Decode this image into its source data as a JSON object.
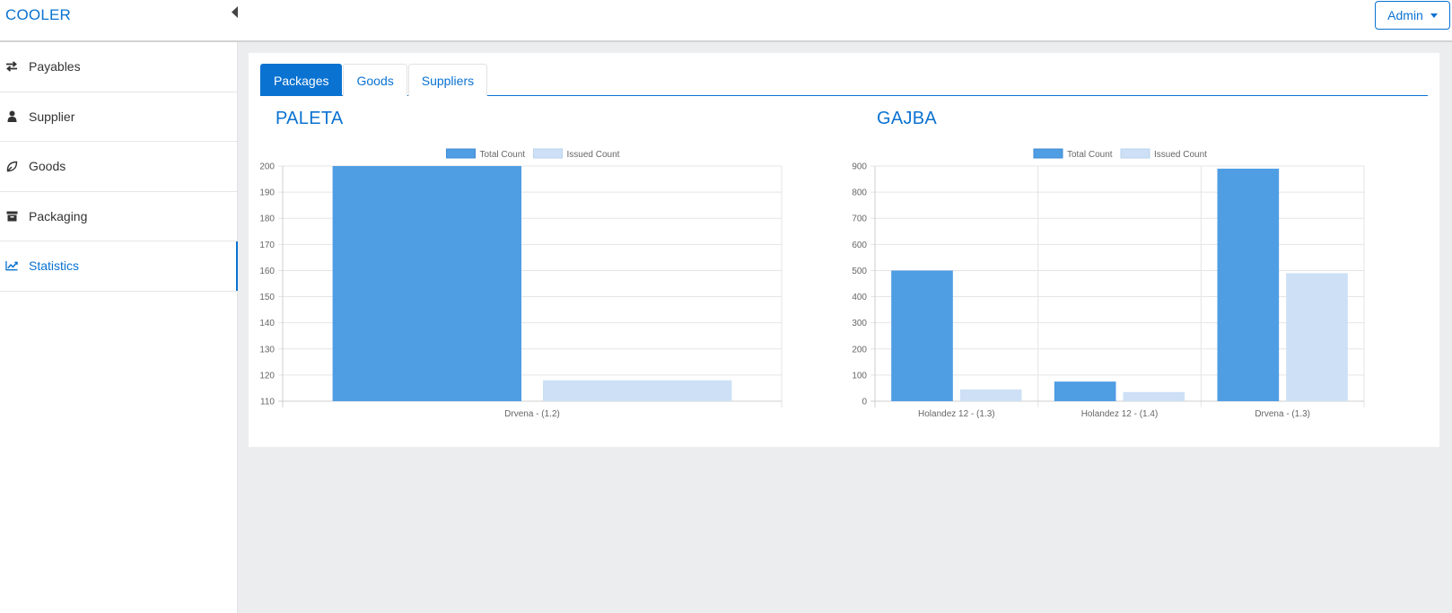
{
  "app": {
    "brand": "COOLER",
    "user_menu_label": "Admin"
  },
  "sidebar": {
    "items": [
      {
        "label": "Payables",
        "icon": "exchange-icon",
        "active": false
      },
      {
        "label": "Supplier",
        "icon": "user-icon",
        "active": false
      },
      {
        "label": "Goods",
        "icon": "leaf-icon",
        "active": false
      },
      {
        "label": "Packaging",
        "icon": "archive-icon",
        "active": false
      },
      {
        "label": "Statistics",
        "icon": "line-chart-icon",
        "active": true
      }
    ]
  },
  "tabs": [
    {
      "label": "Packages",
      "active": true
    },
    {
      "label": "Goods",
      "active": false
    },
    {
      "label": "Suppliers",
      "active": false
    }
  ],
  "colors": {
    "accent": "#0a72d1",
    "total": "#4f9de3",
    "issued": "#cde0f5"
  },
  "chart_data": [
    {
      "type": "bar",
      "title": "PALETA",
      "categories": [
        "Drvena - (1.2)"
      ],
      "series": [
        {
          "name": "Total Count",
          "values": [
            200
          ]
        },
        {
          "name": "Issued Count",
          "values": [
            118
          ]
        }
      ],
      "ylim": [
        110,
        200
      ],
      "yticks": [
        110,
        120,
        130,
        140,
        150,
        160,
        170,
        180,
        190,
        200
      ],
      "legend": "top-center",
      "grid": true
    },
    {
      "type": "bar",
      "title": "GAJBA",
      "categories": [
        "Holandez 12 - (1.3)",
        "Holandez 12 - (1.4)",
        "Drvena - (1.3)"
      ],
      "series": [
        {
          "name": "Total Count",
          "values": [
            500,
            75,
            890
          ]
        },
        {
          "name": "Issued Count",
          "values": [
            45,
            35,
            490
          ]
        }
      ],
      "ylim": [
        0,
        900
      ],
      "yticks": [
        0,
        100,
        200,
        300,
        400,
        500,
        600,
        700,
        800,
        900
      ],
      "legend": "top-center",
      "grid": true
    }
  ]
}
